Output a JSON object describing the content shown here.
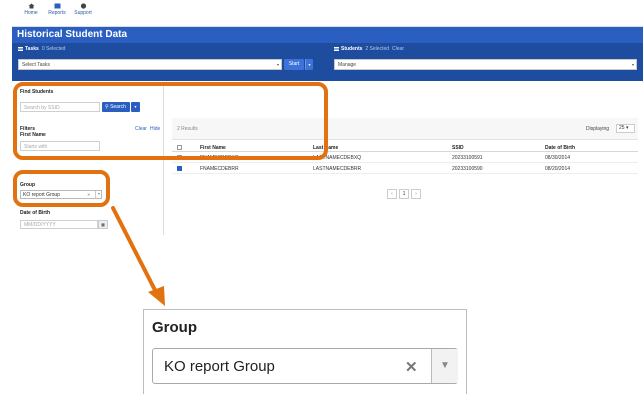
{
  "nav": {
    "items": [
      {
        "label": "Home",
        "icon": "home-icon"
      },
      {
        "label": "Reports",
        "icon": "reports-icon"
      },
      {
        "label": "Support",
        "icon": "support-icon"
      }
    ]
  },
  "title": "Historical Student Data",
  "tasks": {
    "header": "Tasks",
    "selected": "0 Selected",
    "select_value": "Select Tasks",
    "start_label": "Start"
  },
  "students": {
    "header": "Students",
    "selected": "2 Selected",
    "clear": "Clear",
    "select_value": "Manage"
  },
  "find": {
    "header": "Find Students",
    "search_placeholder": "Search by SSID",
    "search_button": "Search"
  },
  "filters": {
    "header": "Filters",
    "clear": "Clear",
    "hide": "Hide",
    "first_name_label": "First Name",
    "first_name_placeholder": "Starts with",
    "group_label": "Group",
    "group_value": "KO report Group",
    "dob_label": "Date of Birth",
    "dob_placeholder": "MM/DD/YYYY"
  },
  "results": {
    "count": "2 Results",
    "displaying_label": "Displaying",
    "displaying_value": "25",
    "columns": [
      "First Name",
      "Last Name",
      "SSID",
      "Date of Birth"
    ],
    "rows": [
      {
        "first": "FNAMECDEBXQ",
        "last": "LASTNAMECDEBXQ",
        "ssid": "20233100591",
        "dob": "08/30/2014",
        "checked": false
      },
      {
        "first": "FNAMECDEBRR",
        "last": "LASTNAMECDEBRR",
        "ssid": "20233100590",
        "dob": "08/20/2014",
        "checked": true
      }
    ],
    "page": "1"
  },
  "zoom": {
    "label": "Group",
    "value": "KO report Group"
  },
  "colors": {
    "brand_blue": "#2a5fc1",
    "highlight_orange": "#e2720f"
  }
}
